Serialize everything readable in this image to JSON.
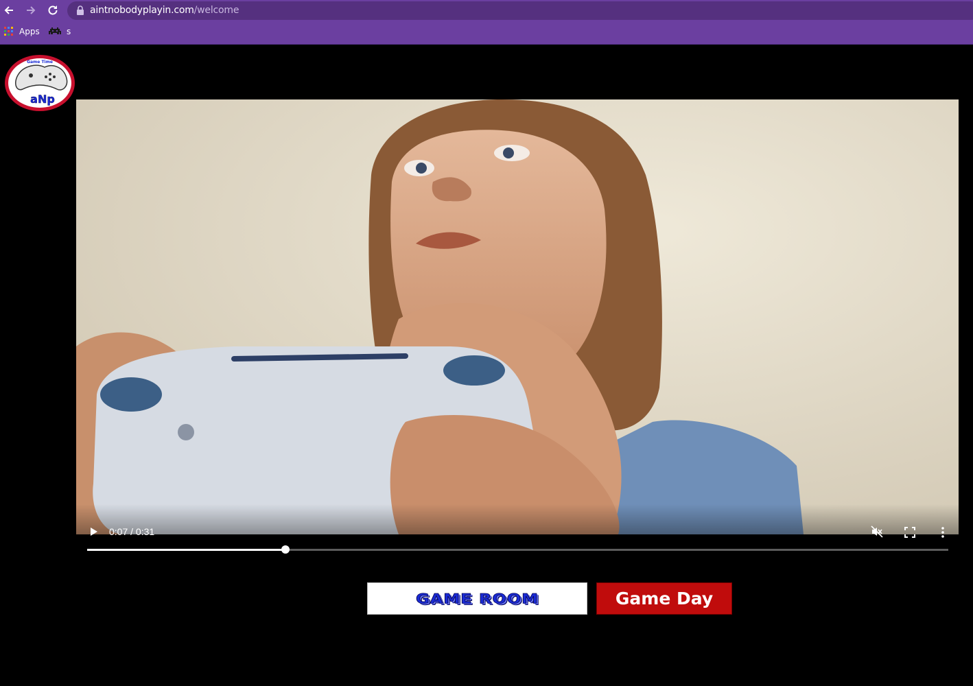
{
  "browser": {
    "url_host": "aintnobodyplayin.com",
    "url_path": "/welcome",
    "bookmarks": [
      {
        "label": "Apps",
        "icon": "apps-grid-icon"
      },
      {
        "label": "s",
        "icon": "space-invader-icon"
      }
    ]
  },
  "logo": {
    "text": "aNp",
    "top_text": "Game Time"
  },
  "video": {
    "current_time": "0:07",
    "duration": "0:31",
    "time_display": "0:07 / 0:31",
    "progress": 0.23,
    "muted": true
  },
  "buttons": {
    "game_room": "GAME ROOM",
    "game_day": "Game Day"
  },
  "colors": {
    "browser_accent": "#6b3fa0",
    "game_room_text": "#1a2bd6",
    "game_day_bg": "#c00c0c"
  }
}
